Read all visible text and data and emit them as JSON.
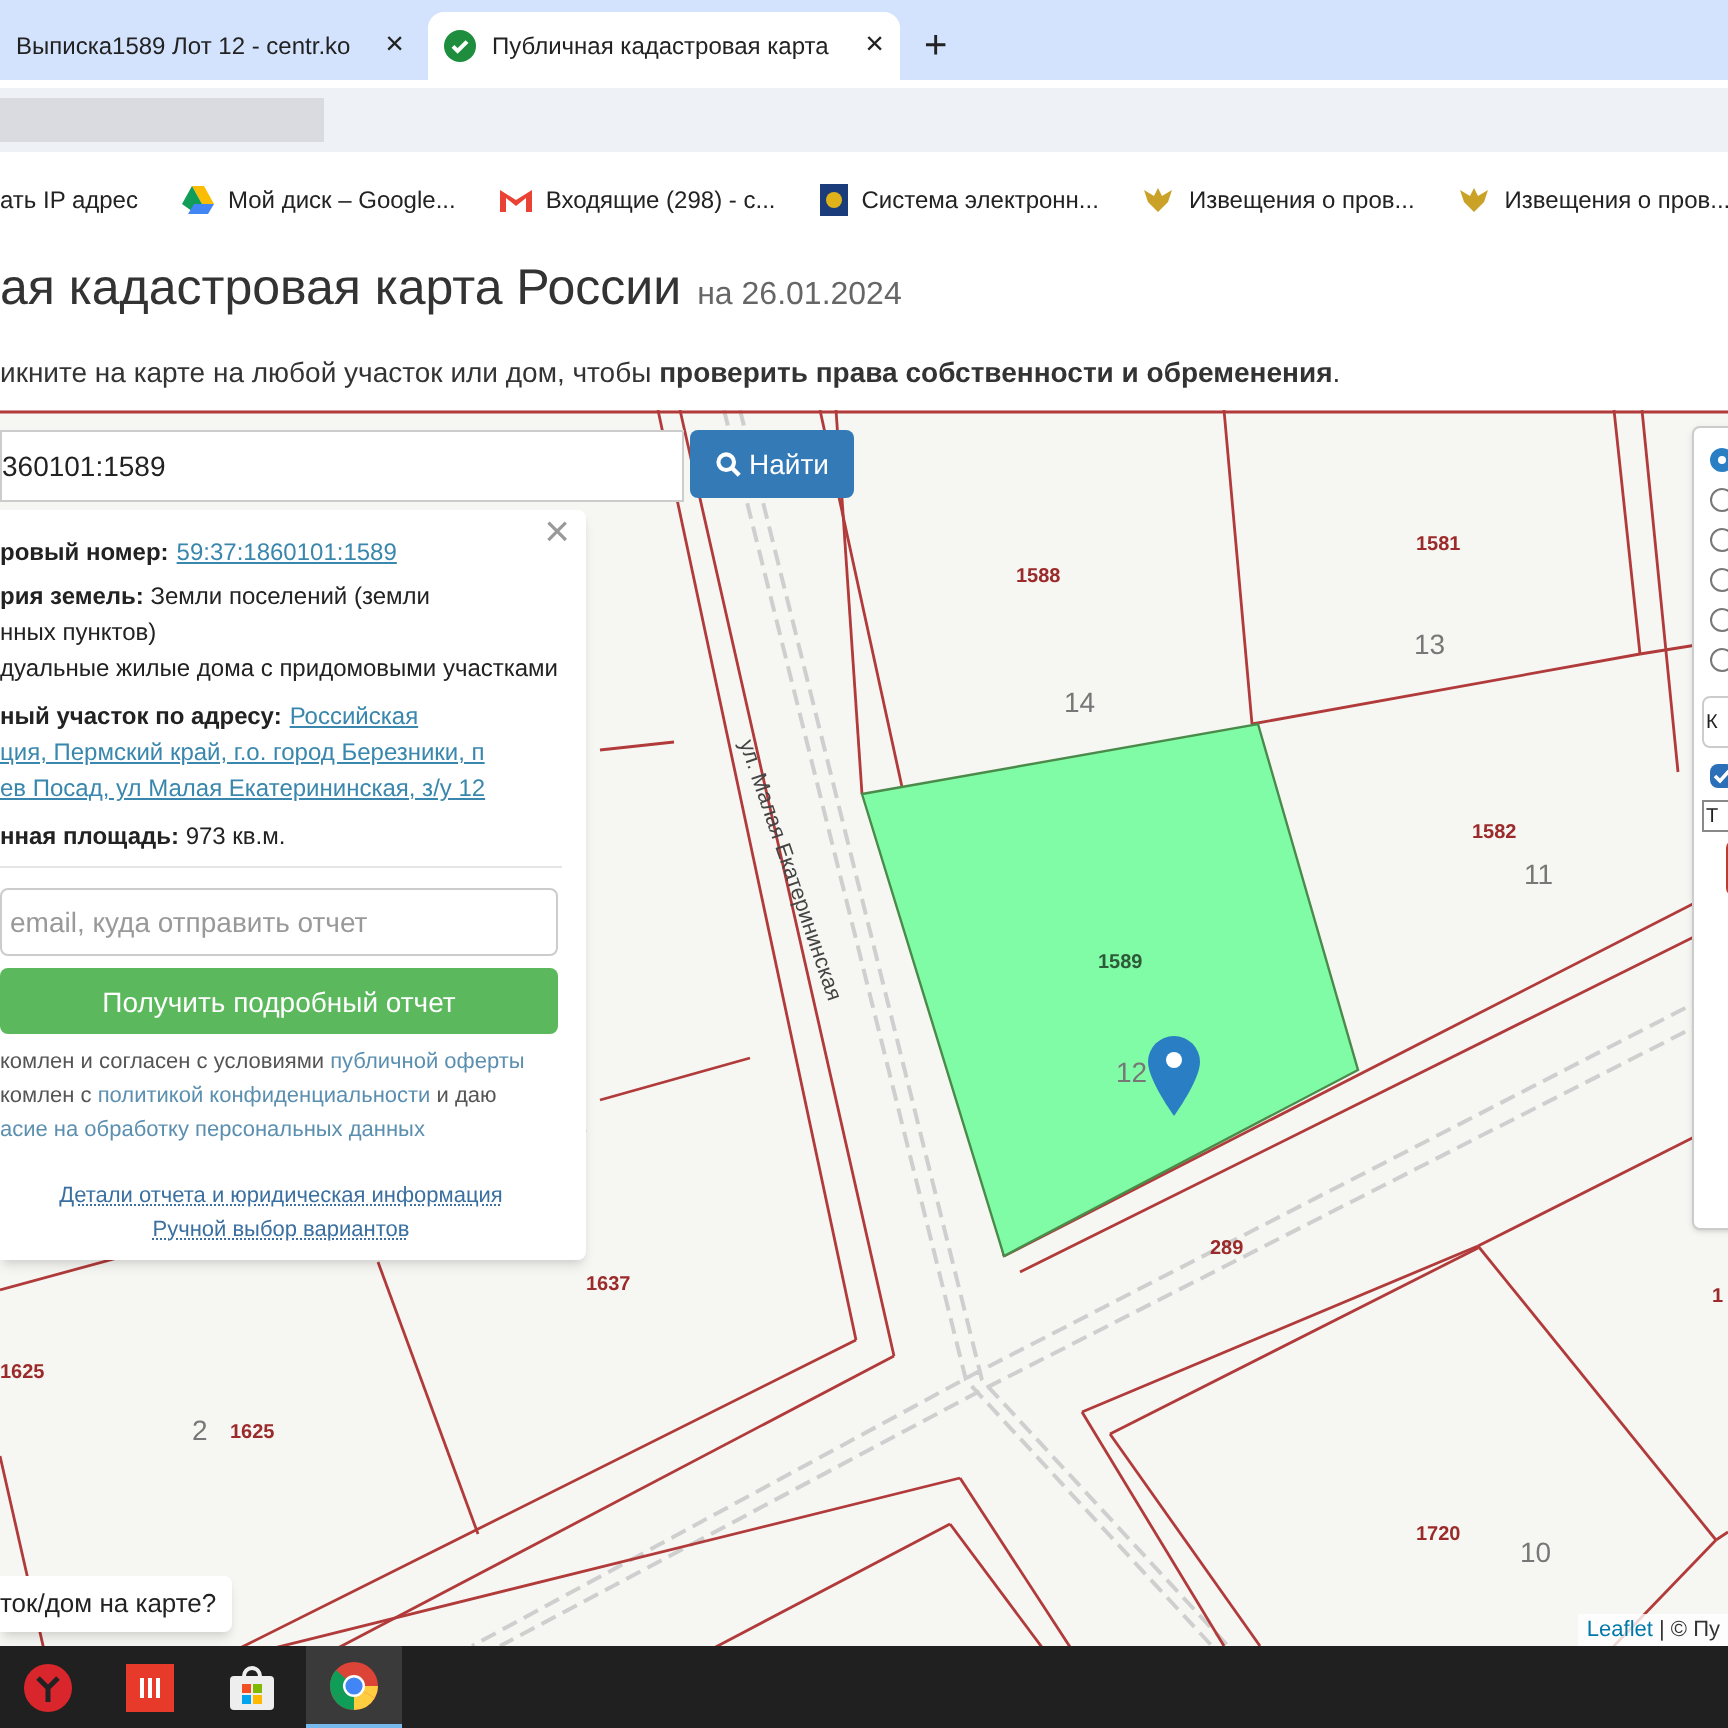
{
  "browser": {
    "tabs": [
      {
        "title": "Выписка1589 Лот 12 - centr.ko",
        "selected": false,
        "close": "×"
      },
      {
        "title": "Публичная кадастровая карта",
        "selected": true,
        "close": "×"
      }
    ],
    "new_tab": "+"
  },
  "bookmarks": [
    {
      "kind": "none",
      "label": "ать IP адрес"
    },
    {
      "kind": "drive",
      "label": "Мой диск – Google..."
    },
    {
      "kind": "mail",
      "label": "Входящие (298) - с..."
    },
    {
      "kind": "emblem",
      "label": "Система электронн..."
    },
    {
      "kind": "eagle",
      "label": "Извещения о пров..."
    },
    {
      "kind": "eagle",
      "label": "Извещения о пров..."
    }
  ],
  "page": {
    "title": "ая кадастровая карта России",
    "date": "на 26.01.2024",
    "subtitle": "икните на карте на любой участок или дом, чтобы **проверить права собственности и обременения**."
  },
  "search": {
    "value": "360101:1589",
    "button": "Найти"
  },
  "info": {
    "close": "×",
    "number_label": "ровый номер:",
    "number_link": "59:37:1860101:1589",
    "category_lines": [
      "**рия земель:** Земли поселений (земли",
      "нных пунктов)"
    ],
    "use": "дуальные жилые дома с придомовыми участками",
    "address_label": "ный участок по адресу:",
    "address_lines": [
      "Российская",
      "ция, Пермский край, г.о. город Березники, п",
      "ев Посад, ул Малая Екатерининская, з/у 12"
    ],
    "area": "**нная площадь:** 973 кв.м.",
    "email_placeholder": "email, куда отправить отчет",
    "report_button": "Получить подробный отчет",
    "consent": [
      {
        "text": "комлен и согласен с условиями ",
        "link": "публичной оферты"
      },
      {
        "text": "комлен с ",
        "link": "политикой конфиденциальности",
        "after": " и даю"
      },
      {
        "link": "асие на обработку персональных данных"
      }
    ],
    "links": [
      "Детали отчета и юридическая информация",
      "Ручной выбор вариантов"
    ]
  },
  "map": {
    "labels": [
      {
        "kind": "parcel",
        "text": "1588"
      },
      {
        "kind": "parcel",
        "text": "1581"
      },
      {
        "kind": "house",
        "text": "13"
      },
      {
        "kind": "house",
        "text": "14"
      },
      {
        "kind": "parcel",
        "text": "1582"
      },
      {
        "kind": "house",
        "text": "11"
      },
      {
        "kind": "selected",
        "text": "1589"
      },
      {
        "kind": "house",
        "text": "12"
      },
      {
        "kind": "parcel",
        "text": "289"
      },
      {
        "kind": "parcel",
        "text": "1637"
      },
      {
        "kind": "parcel",
        "text": "1625"
      },
      {
        "kind": "house",
        "text": "2"
      },
      {
        "kind": "parcel",
        "text": "1625"
      },
      {
        "kind": "parcel",
        "text": "1720"
      },
      {
        "kind": "house",
        "text": "10"
      },
      {
        "kind": "parcel",
        "text": "1"
      },
      {
        "kind": "street",
        "text": "ул. Малая Екатерининская"
      }
    ],
    "help_bubble": "ток/дом на карте?",
    "attribution_link": "Leaflet",
    "attribution_text": " | © Пу"
  },
  "layers": {
    "radios": [
      {
        "selected": true
      },
      {
        "selected": false
      },
      {
        "selected": false
      },
      {
        "selected": false
      },
      {
        "selected": false
      },
      {
        "selected": false
      }
    ],
    "field": "К",
    "checkbox": {
      "checked": true
    },
    "select": "Т"
  },
  "taskbar": [
    {
      "kind": "yandex",
      "selected": false
    },
    {
      "kind": "app",
      "selected": false
    },
    {
      "kind": "store",
      "selected": false
    },
    {
      "kind": "chrome",
      "selected": true
    }
  ]
}
